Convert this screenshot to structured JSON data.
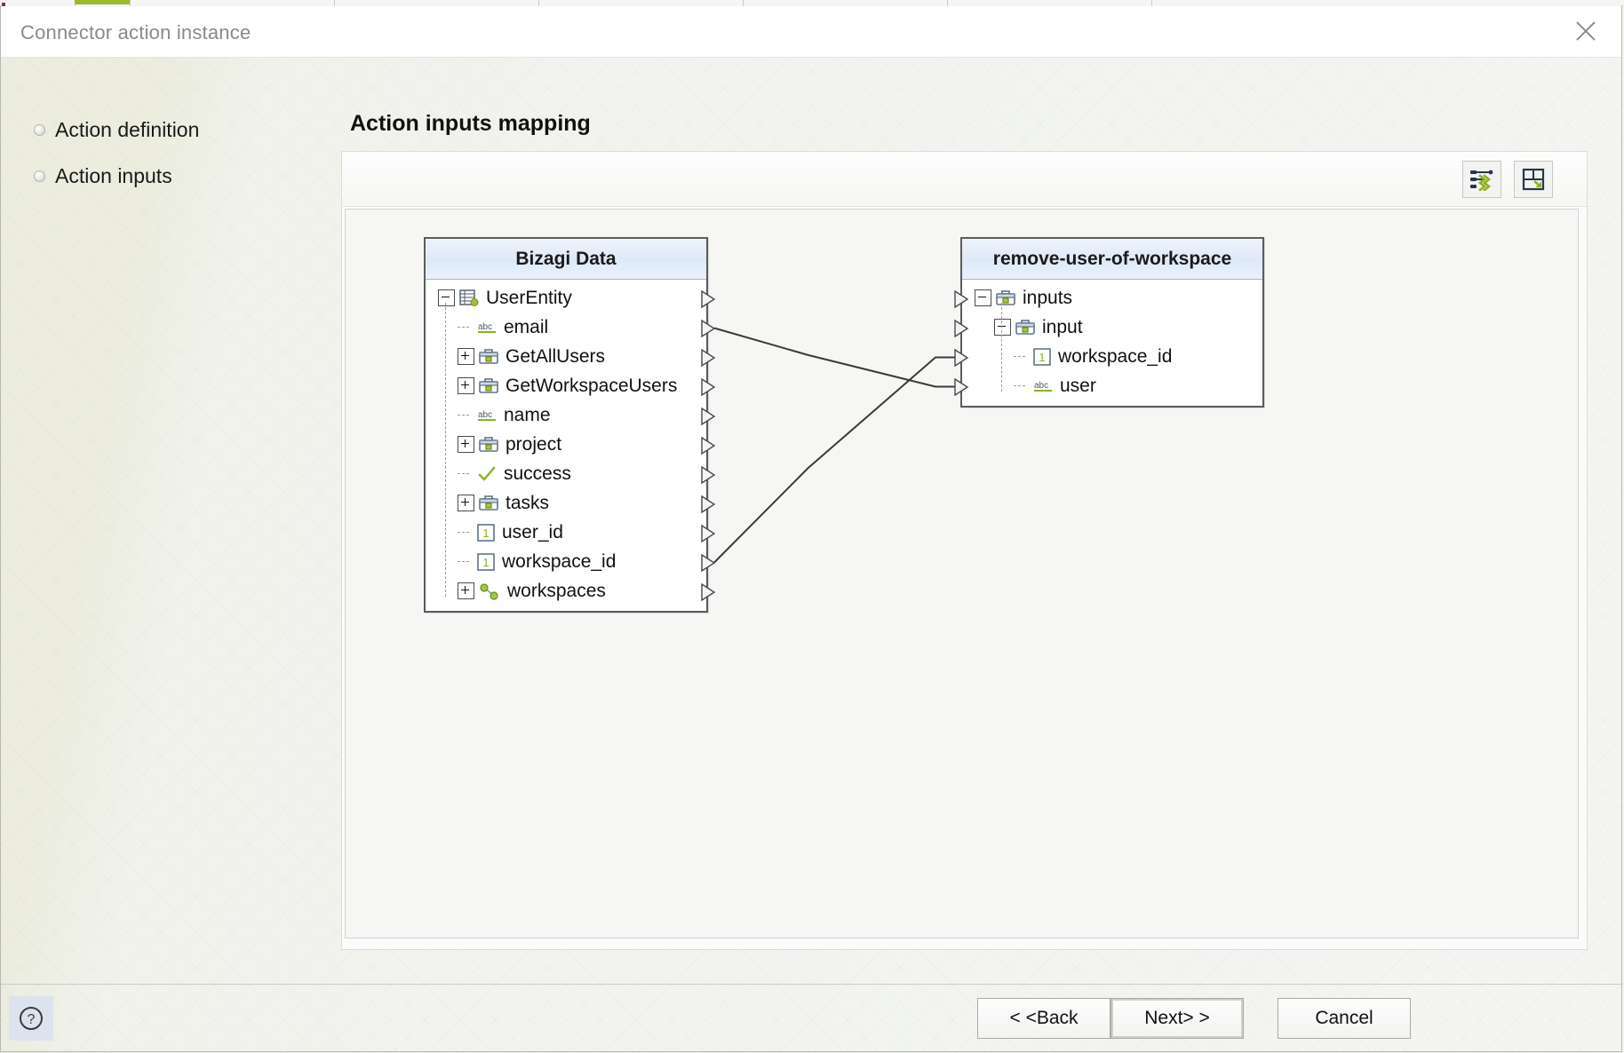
{
  "window": {
    "title": "Connector action instance",
    "close_icon": "close-icon"
  },
  "nav": {
    "items": [
      {
        "label": "Action definition"
      },
      {
        "label": "Action inputs"
      }
    ]
  },
  "page": {
    "heading": "Action inputs mapping"
  },
  "toolbar": {
    "auto_map_icon": "auto-map-icon",
    "fit_layout_icon": "fit-layout-icon"
  },
  "source_panel": {
    "title": "Bizagi Data",
    "rows": [
      {
        "label": "UserEntity",
        "icon": "entity-icon",
        "toggle": "minus",
        "depth": 0,
        "port": true
      },
      {
        "label": "email",
        "icon": "abc-icon",
        "toggle": "stub",
        "depth": 1,
        "port": true
      },
      {
        "label": "GetAllUsers",
        "icon": "briefcase-icon",
        "toggle": "plus",
        "depth": 1,
        "port": true
      },
      {
        "label": "GetWorkspaceUsers",
        "icon": "briefcase-icon",
        "toggle": "plus",
        "depth": 1,
        "port": true
      },
      {
        "label": "name",
        "icon": "abc-icon",
        "toggle": "stub",
        "depth": 1,
        "port": true
      },
      {
        "label": "project",
        "icon": "briefcase-icon",
        "toggle": "plus",
        "depth": 1,
        "port": true
      },
      {
        "label": "success",
        "icon": "check-icon",
        "toggle": "stub",
        "depth": 1,
        "port": true
      },
      {
        "label": "tasks",
        "icon": "briefcase-icon",
        "toggle": "plus",
        "depth": 1,
        "port": true
      },
      {
        "label": "user_id",
        "icon": "number-icon",
        "toggle": "stub",
        "depth": 1,
        "port": true
      },
      {
        "label": "workspace_id",
        "icon": "number-icon",
        "toggle": "stub",
        "depth": 1,
        "port": true
      },
      {
        "label": "workspaces",
        "icon": "relation-icon",
        "toggle": "plus",
        "depth": 1,
        "port": true
      }
    ]
  },
  "target_panel": {
    "title": "remove-user-of-workspace",
    "rows": [
      {
        "label": "inputs",
        "icon": "briefcase-icon",
        "toggle": "minus",
        "depth": 0,
        "port": true
      },
      {
        "label": "input",
        "icon": "briefcase-icon",
        "toggle": "minus",
        "depth": 1,
        "port": true
      },
      {
        "label": "workspace_id",
        "icon": "number-icon",
        "toggle": "stub",
        "depth": 2,
        "port": true
      },
      {
        "label": "user",
        "icon": "abc-icon",
        "toggle": "stub",
        "depth": 2,
        "port": true
      }
    ]
  },
  "mappings": [
    {
      "from": "email",
      "to": "user"
    },
    {
      "from": "workspace_id",
      "to": "workspace_id"
    }
  ],
  "footer": {
    "help_icon": "help-icon",
    "back_label": "< <Back",
    "next_label": "Next> >",
    "cancel_label": "Cancel"
  },
  "colors": {
    "accent_green": "#8db21e",
    "header_blue": "#dee9f8",
    "node_border": "#5c5c5c",
    "title_gray": "#8a8a8a"
  }
}
